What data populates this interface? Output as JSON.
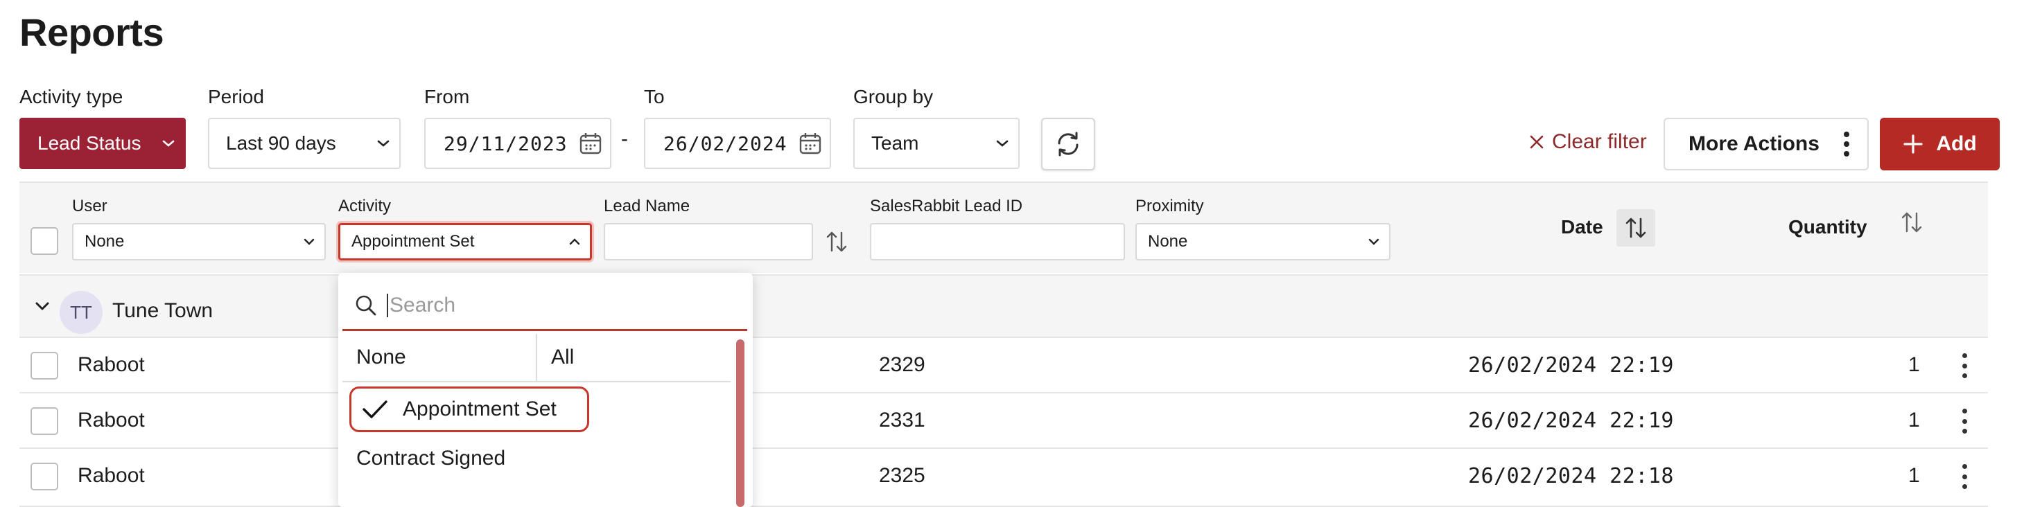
{
  "page": {
    "title": "Reports"
  },
  "toolbar": {
    "activity_type": {
      "label": "Activity type",
      "value": "Lead Status"
    },
    "period": {
      "label": "Period",
      "value": "Last 90 days"
    },
    "from": {
      "label": "From",
      "value": "29/11/2023"
    },
    "range_separator": "-",
    "to": {
      "label": "To",
      "value": "26/02/2024"
    },
    "group_by": {
      "label": "Group by",
      "value": "Team"
    },
    "clear_filter": "Clear filter",
    "more_actions": "More Actions",
    "add": "Add"
  },
  "filters": {
    "user": {
      "label": "User",
      "value": "None"
    },
    "activity": {
      "label": "Activity",
      "value": "Appointment Set"
    },
    "lead_name": {
      "label": "Lead Name",
      "value": ""
    },
    "salesrabbit_lead_id": {
      "label": "SalesRabbit Lead ID",
      "value": ""
    },
    "proximity": {
      "label": "Proximity",
      "value": "None"
    }
  },
  "columns": {
    "date": "Date",
    "quantity": "Quantity"
  },
  "group": {
    "initials": "TT",
    "name": "Tune Town"
  },
  "rows": [
    {
      "user": "Raboot",
      "lead_id": "2329",
      "date": "26/02/2024 22:19",
      "quantity": "1"
    },
    {
      "user": "Raboot",
      "lead_id": "2331",
      "date": "26/02/2024 22:19",
      "quantity": "1"
    },
    {
      "user": "Raboot",
      "lead_id": "2325",
      "date": "26/02/2024 22:18",
      "quantity": "1"
    }
  ],
  "activity_dropdown": {
    "search_placeholder": "Search",
    "none": "None",
    "all": "All",
    "options": [
      {
        "label": "Appointment Set",
        "selected": true
      },
      {
        "label": "Contract Signed",
        "selected": false
      }
    ]
  },
  "colors": {
    "brand": "#9b2234",
    "add_button": "#b62a26",
    "focus_outline": "#c8372d"
  }
}
